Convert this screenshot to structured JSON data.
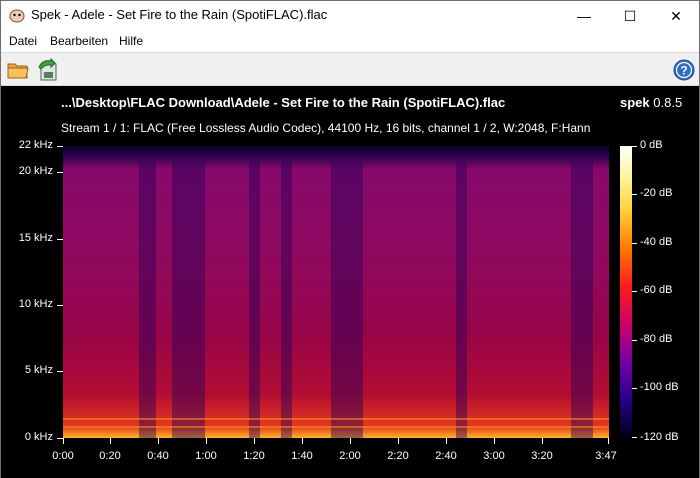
{
  "window": {
    "title": "Spek - Adele - Set Fire to the Rain (SpotiFLAC).flac",
    "minimize_glyph": "—",
    "maximize_glyph": "☐",
    "close_glyph": "✕"
  },
  "menu": {
    "items": [
      "Datei",
      "Bearbeiten",
      "Hilfe"
    ]
  },
  "toolbar": {
    "icons": [
      "open-folder-icon",
      "save-icon",
      "help-icon"
    ]
  },
  "spek": {
    "file_title": "...\\Desktop\\FLAC Download\\Adele - Set Fire to the Rain (SpotiFLAC).flac",
    "brand_name": "spek",
    "version": "0.8.5",
    "stream_info": "Stream 1 / 1: FLAC (Free Lossless Audio Codec), 44100 Hz, 16 bits, channel 1 / 2, W:2048, F:Hann",
    "y_axis": [
      "22 kHz",
      "20 kHz",
      "15 kHz",
      "10 kHz",
      "5 kHz",
      "0 kHz"
    ],
    "x_axis": [
      "0:00",
      "0:20",
      "0:40",
      "1:00",
      "1:20",
      "1:40",
      "2:00",
      "2:20",
      "2:40",
      "3:00",
      "3:20",
      "3:47"
    ],
    "colorbar": [
      "0 dB",
      "-20 dB",
      "-40 dB",
      "-60 dB",
      "-80 dB",
      "-100 dB",
      "-120 dB"
    ]
  }
}
